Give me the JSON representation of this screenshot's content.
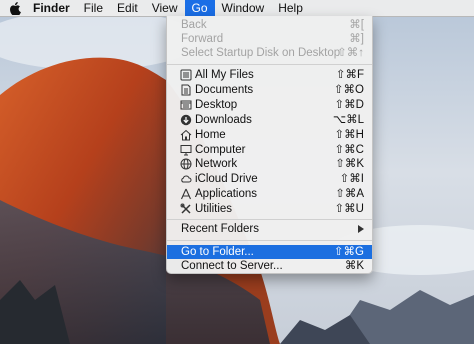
{
  "menubar": {
    "apple_icon": "apple-logo-icon",
    "items": [
      "Finder",
      "File",
      "Edit",
      "View",
      "Go",
      "Window",
      "Help"
    ],
    "active": "Go"
  },
  "go_menu": {
    "history": [
      {
        "label": "Back",
        "shortcut": "⌘[",
        "enabled": false
      },
      {
        "label": "Forward",
        "shortcut": "⌘]",
        "enabled": false
      },
      {
        "label": "Select Startup Disk on Desktop",
        "shortcut": "⇧⌘↑",
        "enabled": false
      }
    ],
    "places": [
      {
        "label": "All My Files",
        "shortcut": "⇧⌘F",
        "icon": "all-my-files-icon"
      },
      {
        "label": "Documents",
        "shortcut": "⇧⌘O",
        "icon": "documents-icon"
      },
      {
        "label": "Desktop",
        "shortcut": "⇧⌘D",
        "icon": "desktop-icon"
      },
      {
        "label": "Downloads",
        "shortcut": "⌥⌘L",
        "icon": "downloads-icon"
      },
      {
        "label": "Home",
        "shortcut": "⇧⌘H",
        "icon": "home-icon"
      },
      {
        "label": "Computer",
        "shortcut": "⇧⌘C",
        "icon": "computer-icon"
      },
      {
        "label": "Network",
        "shortcut": "⇧⌘K",
        "icon": "network-icon"
      },
      {
        "label": "iCloud Drive",
        "shortcut": "⇧⌘I",
        "icon": "icloud-icon"
      },
      {
        "label": "Applications",
        "shortcut": "⇧⌘A",
        "icon": "applications-icon"
      },
      {
        "label": "Utilities",
        "shortcut": "⇧⌘U",
        "icon": "utilities-icon"
      }
    ],
    "recent": {
      "label": "Recent Folders",
      "submenu_icon": "submenu-arrow-icon"
    },
    "goto_folder": {
      "label": "Go to Folder...",
      "shortcut": "⇧⌘G",
      "selected": true
    },
    "connect_server": {
      "label": "Connect to Server...",
      "shortcut": "⌘K"
    }
  },
  "colors": {
    "highlight": "#1c6fe0",
    "menu_background": "#f0f0f0",
    "disabled_text": "#a3a3a3"
  }
}
